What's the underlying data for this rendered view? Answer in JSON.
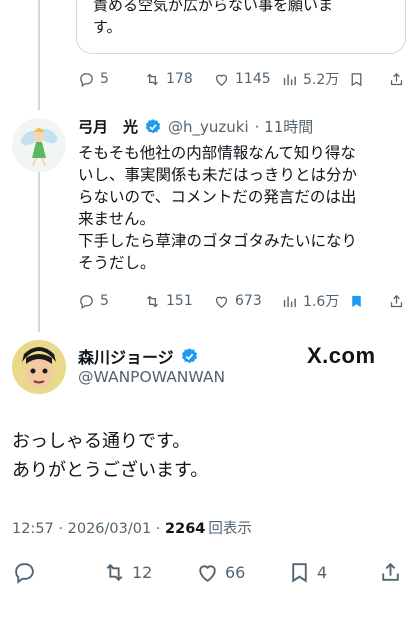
{
  "quoted_text": [
    "責める空気が広がらない事を願いま",
    "す。"
  ],
  "tweet1": {
    "replies": "5",
    "retweets": "178",
    "likes": "1145",
    "views": "5.2万"
  },
  "reply": {
    "display_name": "弓月　光",
    "handle": "@h_yuzuki",
    "time": "· 11時間",
    "text_lines": [
      "そもそも他社の内部情報なんて知り得な",
      "いし、事実関係も未だはっきりとは分か",
      "らないので、コメントだの発言だのは出",
      "来ません。",
      "下手したら草津のゴタゴタみたいになり",
      "そうだし。"
    ],
    "replies": "5",
    "retweets": "151",
    "likes": "673",
    "views": "1.6万"
  },
  "main": {
    "display_name": "森川ジョージ",
    "handle": "@WANPOWANWAN",
    "watermark": "X.com",
    "text_lines": [
      "おっしゃる通りです。",
      "ありがとうございます。"
    ],
    "timestamp": "12:57 · 2026/03/01 · ",
    "view_count": "2264",
    "view_label": "回表示",
    "retweets": "12",
    "likes": "66",
    "bookmarks": "4"
  },
  "colors": {
    "verified": "#1d9bf0",
    "muted": "#536471",
    "bookmark_active": "#1d9bf0"
  }
}
